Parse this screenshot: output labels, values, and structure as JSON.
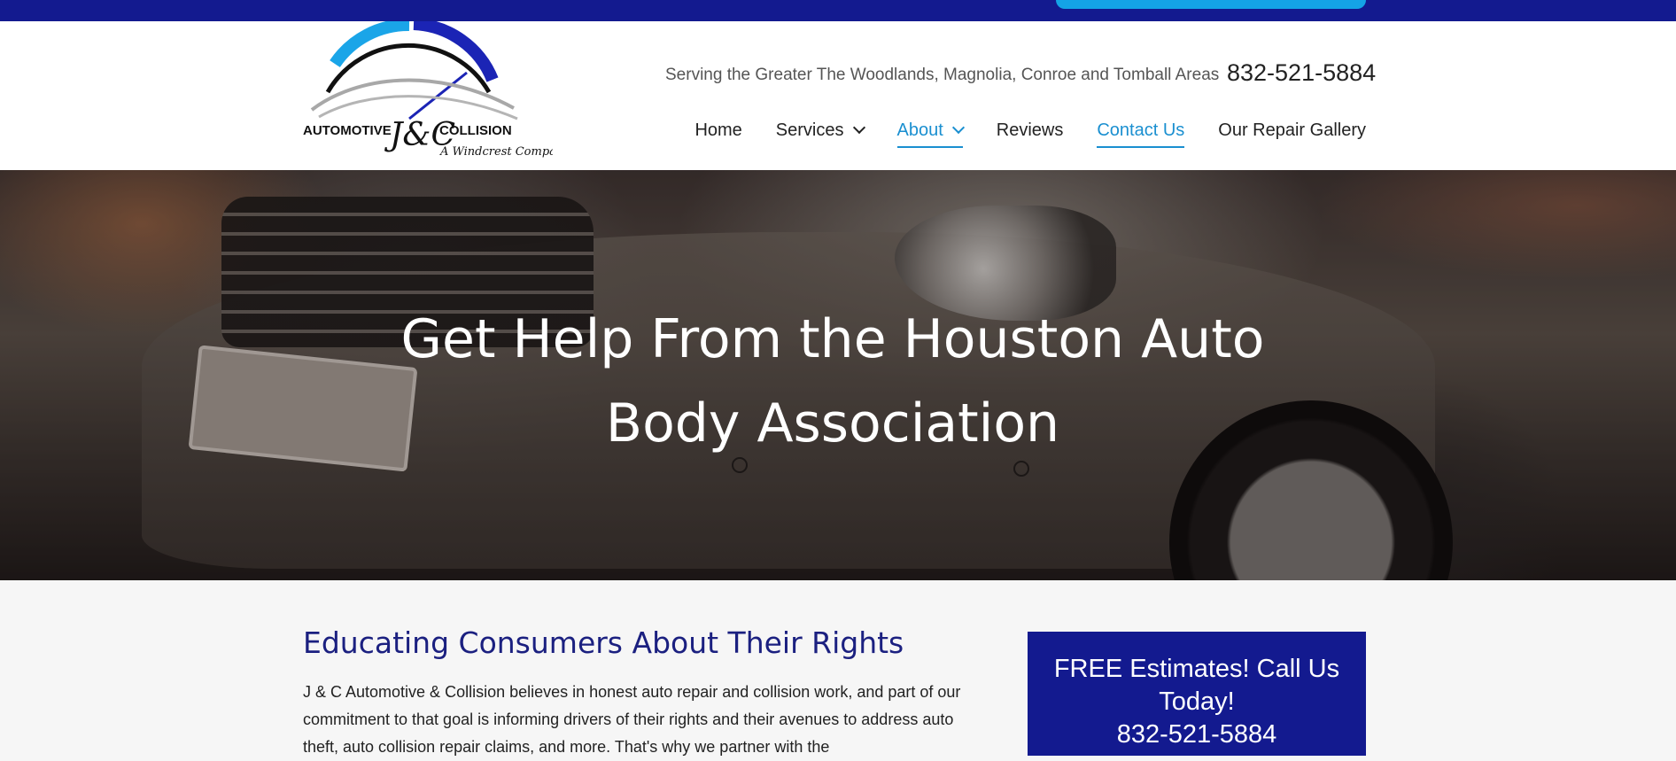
{
  "topbar": {
    "accent": "#131a8f",
    "button_color": "#14a3e6"
  },
  "brand": {
    "name_left": "AUTOMOTIVE",
    "monogram": "J&C",
    "name_right": "COLLISION",
    "subtitle": "A Windcrest Company"
  },
  "header": {
    "tagline": "Serving the Greater The Woodlands, Magnolia, Conroe and Tomball Areas",
    "phone": "832-521-5884"
  },
  "nav": {
    "items": [
      {
        "label": "Home"
      },
      {
        "label": "Services"
      },
      {
        "label": "About"
      },
      {
        "label": "Reviews"
      },
      {
        "label": "Contact Us"
      },
      {
        "label": "Our Repair Gallery"
      }
    ]
  },
  "hero": {
    "title": "Get Help From the Houston Auto Body Association"
  },
  "main": {
    "heading": "Educating Consumers About Their Rights",
    "body": "J & C Automotive & Collision believes in honest auto repair and collision work, and part of our commitment to that goal is informing drivers of their rights and their avenues to address auto theft, auto collision repair claims, and more. That's why we partner with the"
  },
  "cta": {
    "text": "FREE Estimates! Call Us Today!",
    "phone": "832-521-5884"
  },
  "colors": {
    "navy": "#131a8f",
    "link_blue": "#1a8fd0",
    "heading_navy": "#1b2080"
  }
}
